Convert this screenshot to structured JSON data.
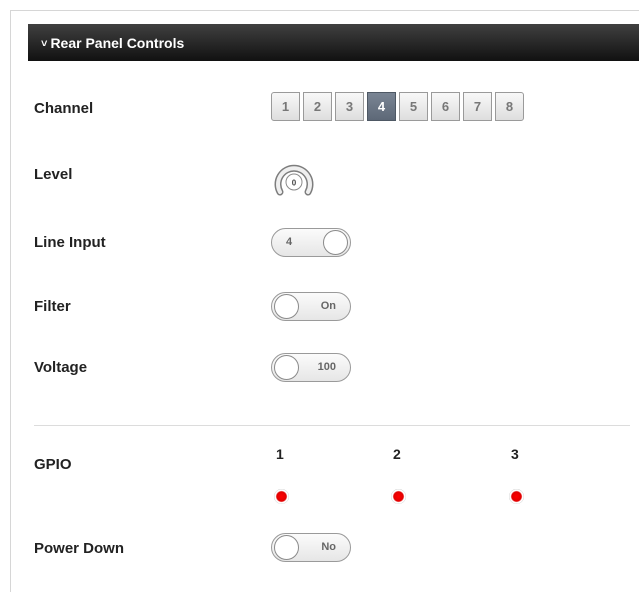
{
  "panel": {
    "title": "Rear Panel Controls",
    "collapse_icon": "chevron-down-icon"
  },
  "channel": {
    "label": "Channel",
    "options": [
      "1",
      "2",
      "3",
      "4",
      "5",
      "6",
      "7",
      "8"
    ],
    "selected": "4"
  },
  "level": {
    "label": "Level",
    "value": "0"
  },
  "line_input": {
    "label": "Line Input",
    "value": "4"
  },
  "filter": {
    "label": "Filter",
    "value": "On"
  },
  "voltage": {
    "label": "Voltage",
    "value": "100"
  },
  "gpio": {
    "label": "GPIO",
    "ports": [
      {
        "number": "1",
        "status_color": "#ff0000"
      },
      {
        "number": "2",
        "status_color": "#ff0000"
      },
      {
        "number": "3",
        "status_color": "#ff0000"
      }
    ]
  },
  "power_down": {
    "label": "Power Down",
    "value": "No"
  },
  "colors": {
    "header_bg": "#1a1a1a",
    "active_channel": "#68717e",
    "led": "#ff0000"
  }
}
